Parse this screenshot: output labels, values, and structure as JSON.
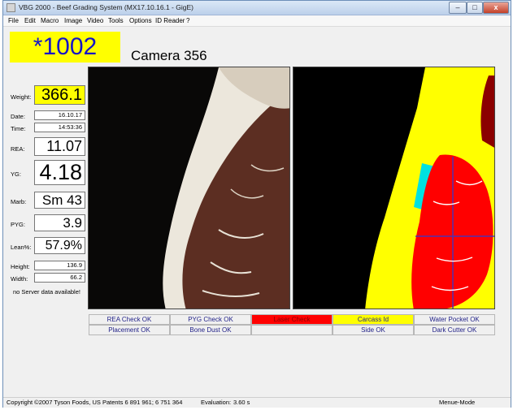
{
  "window": {
    "title": "VBG 2000 - Beef Grading System  (MX17.10.16.1 - GigE)",
    "buttons": {
      "minimize": "–",
      "maximize": "□",
      "close": "x"
    }
  },
  "menu": [
    "File",
    "Edit",
    "Macro",
    "Image",
    "Video",
    "Tools",
    "Options",
    "ID Reader",
    "?"
  ],
  "carcass_id": "*1002",
  "camera": "Camera 356",
  "fields": {
    "weight": {
      "label": "Weight:",
      "value": "366.1"
    },
    "date": {
      "label": "Date:",
      "value": "16.10.17"
    },
    "time": {
      "label": "Time:",
      "value": "14:53:36"
    },
    "rea": {
      "label": "REA:",
      "value": "11.07"
    },
    "yg": {
      "label": "YG:",
      "value": "4.18"
    },
    "marb": {
      "label": "Marb:",
      "value": "Sm 43"
    },
    "pyg": {
      "label": "PYG:",
      "value": "3.9"
    },
    "lean": {
      "label": "Lean%:",
      "value": "57.9%"
    },
    "height": {
      "label": "Height:",
      "value": "136.9"
    },
    "width": {
      "label": "Width:",
      "value": "66.2"
    }
  },
  "server_message": "no Server data available!",
  "status": {
    "rea_check": "REA Check  OK",
    "pyg_check": "PYG Check  OK",
    "laser_check": "Laser Check",
    "carcass_id": "Carcass Id",
    "water_pocket": "Water Pocket  OK",
    "placement": "Placement  OK",
    "bone_dust": "Bone Dust  OK",
    "empty": "",
    "side": "Side  OK",
    "dark_cutter": "Dark Cutter  OK"
  },
  "status_colors": {
    "laser_check": "#ff0000",
    "carcass_id": "#ffff00",
    "ok": "#f0f0f0"
  },
  "statusbar": {
    "copyright": "Copyright ©2007 Tyson Foods, US Patents 6 891 961; 6 751 364",
    "evaluation_label": "Evaluation:",
    "evaluation_value": "3.60 s",
    "mode": "Menue-Mode"
  }
}
